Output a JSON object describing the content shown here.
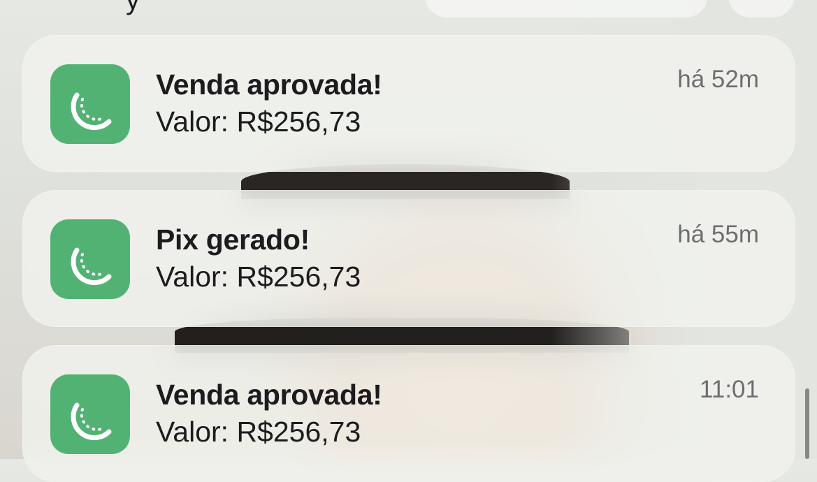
{
  "top": {
    "partial_glyph": "y"
  },
  "notifications": [
    {
      "icon": "melon-slice-icon",
      "title": "Venda aprovada!",
      "body": "Valor: R$256,73",
      "time": "há 52m"
    },
    {
      "icon": "melon-slice-icon",
      "title": "Pix gerado!",
      "body": "Valor: R$256,73",
      "time": "há 55m"
    },
    {
      "icon": "melon-slice-icon",
      "title": "Venda aprovada!",
      "body": "Valor: R$256,73",
      "time": "11:01"
    }
  ],
  "colors": {
    "app_icon_bg": "#52b274",
    "card_bg": "#f1f2ee",
    "time_text": "#6e6e70"
  }
}
